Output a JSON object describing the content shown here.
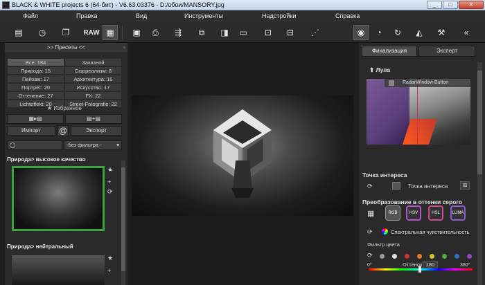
{
  "window": {
    "title": "BLACK & WHITE projects 6 (64-бит) - V6.63.03376 - D:/обои/MANSORY.jpg",
    "min": "_",
    "max": "□",
    "close": "✕"
  },
  "menu": [
    "Файл",
    "Правка",
    "Вид",
    "Инструменты",
    "Надстройки",
    "Справка"
  ],
  "toolbar": {
    "raw_label": "RAW"
  },
  "presets": {
    "header": ">> Пресеты <<",
    "pin": "▫",
    "all": "Все: 184",
    "custom": "Заказной",
    "categories": [
      "Природа: 15",
      "Сюрреализм: 8",
      "Пейзаж: 17",
      "Архитектура: 16",
      "Портрет: 20",
      "Искусство: 17",
      "Оттенение: 27",
      "FX: 22",
      "Lichteffekt: 20",
      "Street-Fotografie: 22"
    ],
    "favorites": "★ Избранное",
    "import": "Импорт",
    "export": "Экспорт",
    "at": "@",
    "filter_value": "-без фильтра -",
    "filter_arrow": "▾",
    "preset1": "Природа> высокое качество",
    "preset2": "Природа> нейтральный",
    "star": "★",
    "plus": "+",
    "sync": "⟳"
  },
  "right": {
    "tab_final": "Финализация",
    "tab_expert": "Эксперт",
    "loupe": "Лупа",
    "loupe_arrow": "⬆",
    "radar_btn": "RadarWindow Button",
    "poi_title": "Точка интереса",
    "poi_label": "Точка интереса",
    "gray_title": "Преобразование в оттенки серого",
    "modes": [
      "RGB",
      "HSV",
      "HSL",
      "LUMA"
    ],
    "spectral": "Спектральная чувствительность",
    "color_filter": "Фильтр цвета",
    "hue_label": "Оттенок",
    "hue_value": "180",
    "hue_min": "0°",
    "hue_max": "360°",
    "colors": {
      "accent_green": "#3ca33c"
    }
  }
}
